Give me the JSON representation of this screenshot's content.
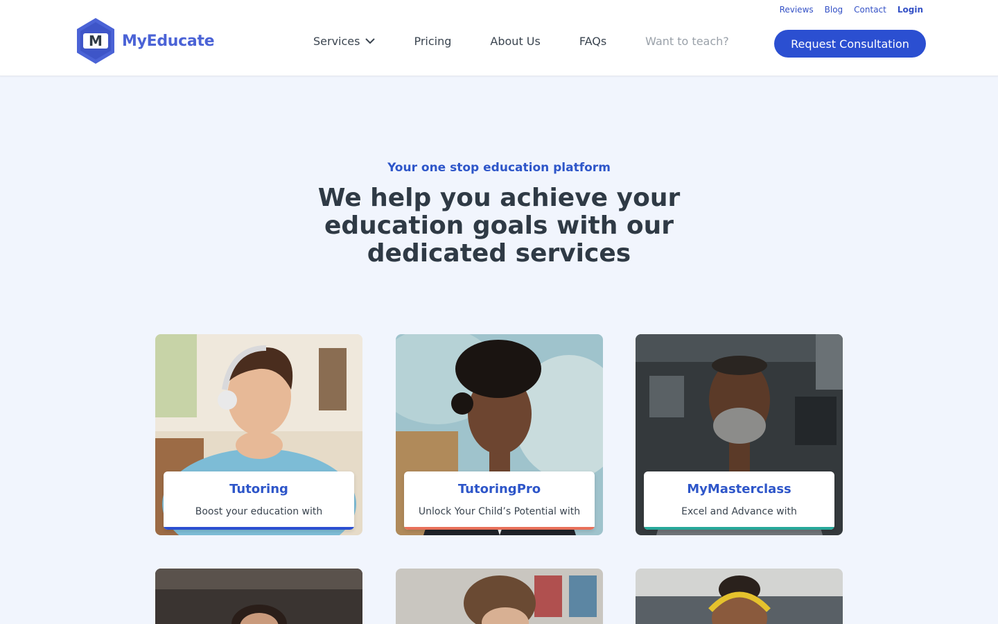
{
  "header": {
    "top_links": [
      "Reviews",
      "Blog",
      "Contact",
      "Login"
    ],
    "logo_text": "MyEducate",
    "logo_letter": "M",
    "nav": {
      "services": "Services",
      "pricing": "Pricing",
      "about": "About Us",
      "faqs": "FAQs",
      "teach": "Want to teach?"
    },
    "cta": "Request Consultation"
  },
  "hero": {
    "kicker": "Your one stop education platform",
    "title": "We help you achieve your education goals with our dedicated services"
  },
  "cards": [
    {
      "title": "Tutoring",
      "desc": "Boost your education with",
      "accent": "#2b4fd1"
    },
    {
      "title": "TutoringPro",
      "desc": "Unlock Your Child’s Potential with",
      "accent": "#e8705a"
    },
    {
      "title": "MyMasterclass",
      "desc": "Excel and Advance with",
      "accent": "#27a89a"
    }
  ],
  "colors": {
    "brand": "#2b4fd1",
    "logo": "#4b63d6",
    "background": "#f1f5fd"
  }
}
